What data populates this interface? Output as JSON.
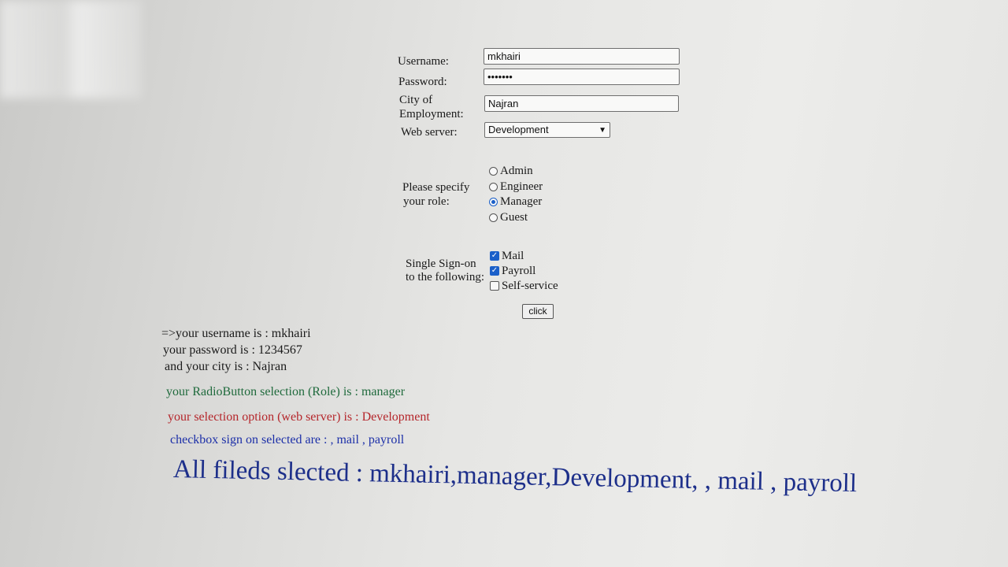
{
  "form": {
    "username": {
      "label": "Username:",
      "value": "mkhairi"
    },
    "password": {
      "label": "Password:",
      "value": "•••••••"
    },
    "city": {
      "label_line1": "City of",
      "label_line2": "Employment:",
      "value": "Najran"
    },
    "web_server": {
      "label": "Web server:",
      "selected": "Development"
    },
    "role": {
      "label_line1": "Please specify",
      "label_line2": "your role:",
      "options": [
        "Admin",
        "Engineer",
        "Manager",
        "Guest"
      ],
      "selected": "Manager"
    },
    "sso": {
      "label_line1": "Single Sign-on",
      "label_line2": "to the following:",
      "options": [
        {
          "label": "Mail",
          "checked": true
        },
        {
          "label": "Payroll",
          "checked": true
        },
        {
          "label": "Self-service",
          "checked": false
        }
      ]
    },
    "submit_label": "click"
  },
  "output": {
    "line_username": "=>your username is : mkhairi",
    "line_password": "your password is : 1234567",
    "line_city": "and your city is : Najran",
    "line_role": "your RadioButton selection (Role) is : manager",
    "line_server": "your selection option (web server) is : Development",
    "line_checkbox": "checkbox sign on selected are : , mail , payroll",
    "line_all": "All fileds slected : mkhairi,manager,Development, , mail , payroll"
  },
  "colors": {
    "role_text": "#1f6a3c",
    "server_text": "#b5262b",
    "checkbox_text": "#1c2fa8",
    "all_text": "#1d2f8a",
    "accent": "#1a5fc9"
  }
}
